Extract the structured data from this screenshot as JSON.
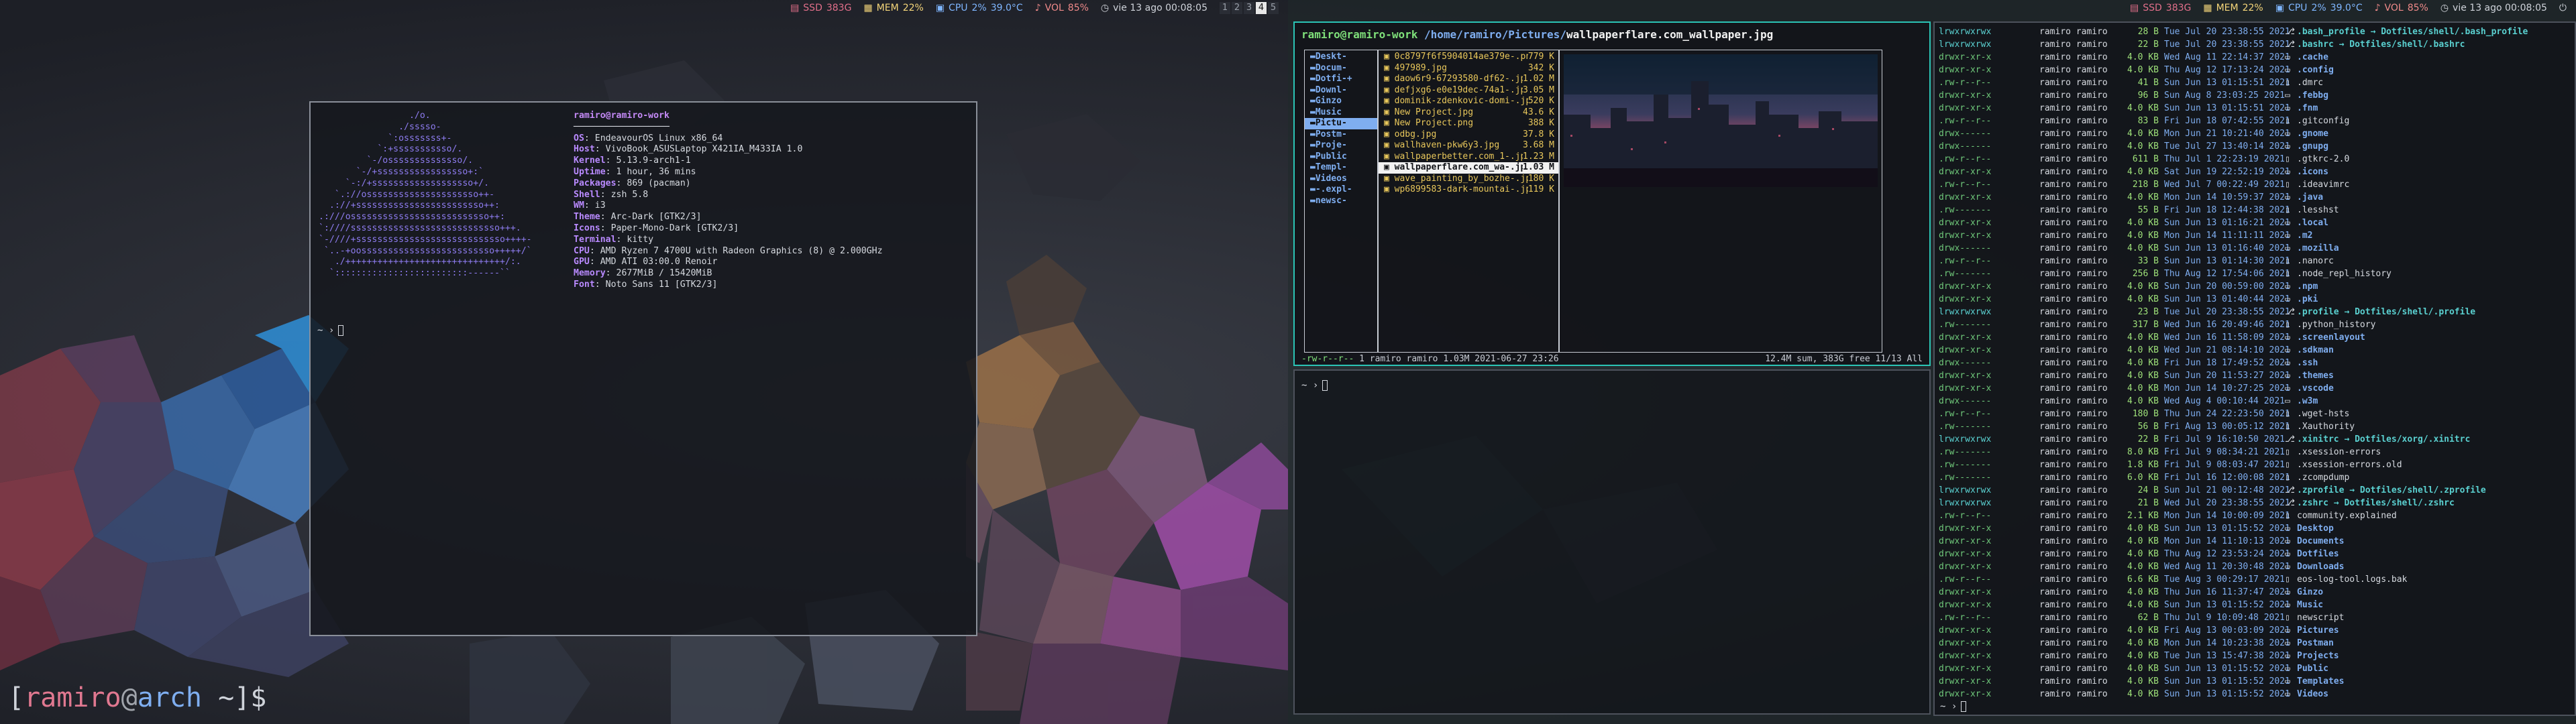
{
  "status_left": {
    "ssd_label": "SSD",
    "ssd_value": "383G",
    "mem_label": "MEM",
    "mem_value": "22%",
    "cpu_label": "CPU",
    "cpu_value": "2%",
    "temp": "39.0°C",
    "vol_label": "VOL",
    "vol_value": "85%",
    "clock": "vie 13 ago 00:08:05",
    "workspaces": [
      "1",
      "2",
      "3",
      "4",
      "5"
    ],
    "active_workspace": "4"
  },
  "status_right": {
    "ssd_label": "SSD",
    "ssd_value": "383G",
    "mem_label": "MEM",
    "mem_value": "22%",
    "cpu_label": "CPU",
    "cpu_value": "2%",
    "temp": "39.0°C",
    "vol_label": "VOL",
    "vol_value": "85%",
    "clock": "vie 13 ago 00:08:05"
  },
  "neofetch": {
    "user_host": "ramiro@ramiro-work",
    "separator": "──────────────────",
    "logo": "                 ./o.\n               ./sssso-\n             `:osssssss+-\n           `:+sssssssssso/.\n         `-/ossssssssssssso/.\n       `-/+sssssssssssssssso+:`\n     `-:/+sssssssssssssssssso+/.\n   `.://osssssssssssssssssssso++-\n  .://+ssssssssssssssssssssssso++:\n.:///ossssssssssssssssssssssssso++:\n`:////ssssssssssssssssssssssssssso+++.\n`-////+ssssssssssssssssssssssssssso++++-\n `..-+oosssssssssssssssssssssssso+++++/`\n   ./++++++++++++++++++++++++++++++/:.\n  `:::::::::::::::::::::::::------``",
    "lines": [
      {
        "k": "OS",
        "v": "EndeavourOS Linux x86_64"
      },
      {
        "k": "Host",
        "v": "VivoBook_ASUSLaptop X421IA_M433IA 1.0"
      },
      {
        "k": "Kernel",
        "v": "5.13.9-arch1-1"
      },
      {
        "k": "Uptime",
        "v": "1 hour, 36 mins"
      },
      {
        "k": "Packages",
        "v": "869 (pacman)"
      },
      {
        "k": "Shell",
        "v": "zsh 5.8"
      },
      {
        "k": "WM",
        "v": "i3"
      },
      {
        "k": "Theme",
        "v": "Arc-Dark [GTK2/3]"
      },
      {
        "k": "Icons",
        "v": "Paper-Mono-Dark [GTK2/3]"
      },
      {
        "k": "Terminal",
        "v": "kitty"
      },
      {
        "k": "CPU",
        "v": "AMD Ryzen 7 4700U with Radeon Graphics (8) @ 2.000GHz"
      },
      {
        "k": "GPU",
        "v": "AMD ATI 03:00.0 Renoir"
      },
      {
        "k": "Memory",
        "v": "2677MiB / 15420MiB"
      },
      {
        "k": "Font",
        "v": "Noto Sans 11 [GTK2/3]"
      }
    ],
    "prompt": "~ ›"
  },
  "desktop_prompt": {
    "open": "[",
    "user": "ramiro",
    "at": "@",
    "host": "arch",
    "rest": " ~]$"
  },
  "ranger": {
    "title_user": "ramiro@ramiro-work",
    "title_path": " /home/ramiro/Pictures/",
    "title_file": "wallpaperflare.com_wallpaper.jpg",
    "parent_dirs": [
      "Deskt-",
      "Docum-",
      "Dotfi-+",
      "Downl-",
      "Ginzo",
      "Music",
      "Pictu-",
      "Postm-",
      "Proje-",
      "Public",
      "Templ-",
      "Videos",
      "-.expl-",
      "newsc-"
    ],
    "parent_selected": "Pictu-",
    "files": [
      {
        "name": "0c8797f6f5904014ae379e-.png",
        "size": "779 K"
      },
      {
        "name": "497989.jpg",
        "size": "342 K"
      },
      {
        "name": "daow6r9-67293580-df62-.jpg",
        "size": "1.02 M"
      },
      {
        "name": "defjxg6-e0e19dec-74a1-.jpg",
        "size": "3.05 M"
      },
      {
        "name": "dominik-zdenkovic-domi-.jpg",
        "size": "520 K"
      },
      {
        "name": "New Project.jpg",
        "size": "43.6 K"
      },
      {
        "name": "New Project.png",
        "size": "388 K"
      },
      {
        "name": "odbg.jpg",
        "size": "37.8 K"
      },
      {
        "name": "wallhaven-pkw6y3.jpg",
        "size": "3.68 M"
      },
      {
        "name": "wallpaperbetter.com_1-.jpg",
        "size": "1.23 M"
      },
      {
        "name": "wallpaperflare.com_wa-.jpg",
        "size": "1.03 M"
      },
      {
        "name": "wave_painting_by_bozhe-.jpg",
        "size": "180 K"
      },
      {
        "name": "wp6899583-dark-mountai-.jpg",
        "size": "119 K"
      }
    ],
    "selected_file": "wallpaperflare.com_wa-.jpg",
    "status_perm": "-rw-r--r--",
    "status_info": " 1 ramiro ramiro 1.03M 2021-06-27 23:26",
    "status_right": "12.4M sum, 383G free  11/13  All"
  },
  "term2": {
    "prompt": "~ ›"
  },
  "ls": {
    "rows": [
      {
        "p": "lrwxrwxrwx",
        "o": "ramiro ramiro",
        "s": "28 B",
        "d": "Tue Jul 20 23:38:55 2021",
        "i": "⎇",
        "n": ".bash_profile → Dotfiles/shell/.bash_profile",
        "t": "ln"
      },
      {
        "p": "lrwxrwxrwx",
        "o": "ramiro ramiro",
        "s": "22 B",
        "d": "Tue Jul 20 23:38:55 2021",
        "i": "⎇",
        "n": ".bashrc → Dotfiles/shell/.bashrc",
        "t": "ln"
      },
      {
        "p": "drwxr-xr-x",
        "o": "ramiro ramiro",
        "s": "4.0 KB",
        "d": "Wed Aug 11 22:14:37 2021",
        "i": "▭",
        "n": ".cache",
        "t": "d"
      },
      {
        "p": "drwxr-xr-x",
        "o": "ramiro ramiro",
        "s": "4.0 KB",
        "d": "Thu Aug 12 17:13:24 2021",
        "i": "▭",
        "n": ".config",
        "t": "d"
      },
      {
        "p": ".rw-r--r--",
        "o": "ramiro ramiro",
        "s": "41 B",
        "d": "Sun Jun 13 01:15:51 2021",
        "i": "▯",
        "n": ".dmrc",
        "t": "f"
      },
      {
        "p": "drwxr-xr-x",
        "o": "ramiro ramiro",
        "s": "96 B",
        "d": "Sun Aug 8 23:03:25 2021",
        "i": "▭",
        "n": ".febbg",
        "t": "d"
      },
      {
        "p": "drwxr-xr-x",
        "o": "ramiro ramiro",
        "s": "4.0 KB",
        "d": "Sun Jun 13 01:15:51 2021",
        "i": "▭",
        "n": ".fnm",
        "t": "d"
      },
      {
        "p": ".rw-r--r--",
        "o": "ramiro ramiro",
        "s": "83 B",
        "d": "Fri Jun 18 07:42:55 2021",
        "i": "▯",
        "n": ".gitconfig",
        "t": "f"
      },
      {
        "p": "drwx------",
        "o": "ramiro ramiro",
        "s": "4.0 KB",
        "d": "Mon Jun 21 10:21:40 2021",
        "i": "▭",
        "n": ".gnome",
        "t": "d"
      },
      {
        "p": "drwx------",
        "o": "ramiro ramiro",
        "s": "4.0 KB",
        "d": "Tue Jul 27 13:40:14 2021",
        "i": "▭",
        "n": ".gnupg",
        "t": "d"
      },
      {
        "p": ".rw-r--r--",
        "o": "ramiro ramiro",
        "s": "611 B",
        "d": "Thu Jul 1 22:23:19 2021",
        "i": "▯",
        "n": ".gtkrc-2.0",
        "t": "f"
      },
      {
        "p": "drwxr-xr-x",
        "o": "ramiro ramiro",
        "s": "4.0 KB",
        "d": "Sat Jun 19 22:52:19 2021",
        "i": "▭",
        "n": ".icons",
        "t": "d"
      },
      {
        "p": ".rw-r--r--",
        "o": "ramiro ramiro",
        "s": "218 B",
        "d": "Wed Jul 7 00:22:49 2021",
        "i": "▯",
        "n": ".ideavimrc",
        "t": "f"
      },
      {
        "p": "drwxr-xr-x",
        "o": "ramiro ramiro",
        "s": "4.0 KB",
        "d": "Mon Jun 14 10:59:37 2021",
        "i": "▭",
        "n": ".java",
        "t": "d"
      },
      {
        "p": ".rw-------",
        "o": "ramiro ramiro",
        "s": "55 B",
        "d": "Fri Jun 18 12:44:38 2021",
        "i": "▯",
        "n": ".lesshst",
        "t": "f"
      },
      {
        "p": "drwxr-xr-x",
        "o": "ramiro ramiro",
        "s": "4.0 KB",
        "d": "Sun Jun 13 01:16:21 2021",
        "i": "▭",
        "n": ".local",
        "t": "d"
      },
      {
        "p": "drwxr-xr-x",
        "o": "ramiro ramiro",
        "s": "4.0 KB",
        "d": "Mon Jun 14 11:11:11 2021",
        "i": "▭",
        "n": ".m2",
        "t": "d"
      },
      {
        "p": "drwx------",
        "o": "ramiro ramiro",
        "s": "4.0 KB",
        "d": "Sun Jun 13 01:16:40 2021",
        "i": "▭",
        "n": ".mozilla",
        "t": "d"
      },
      {
        "p": ".rw-r--r--",
        "o": "ramiro ramiro",
        "s": "33 B",
        "d": "Sun Jun 13 01:14:30 2021",
        "i": "▯",
        "n": ".nanorc",
        "t": "f"
      },
      {
        "p": ".rw-------",
        "o": "ramiro ramiro",
        "s": "256 B",
        "d": "Thu Aug 12 17:54:06 2021",
        "i": "▯",
        "n": ".node_repl_history",
        "t": "f"
      },
      {
        "p": "drwxr-xr-x",
        "o": "ramiro ramiro",
        "s": "4.0 KB",
        "d": "Sun Jun 20 00:59:00 2021",
        "i": "▭",
        "n": ".npm",
        "t": "d"
      },
      {
        "p": "drwxr-xr-x",
        "o": "ramiro ramiro",
        "s": "4.0 KB",
        "d": "Sun Jun 13 01:40:44 2021",
        "i": "▭",
        "n": ".pki",
        "t": "d"
      },
      {
        "p": "lrwxrwxrwx",
        "o": "ramiro ramiro",
        "s": "23 B",
        "d": "Tue Jul 20 23:38:55 2021",
        "i": "⎇",
        "n": ".profile → Dotfiles/shell/.profile",
        "t": "ln"
      },
      {
        "p": ".rw-------",
        "o": "ramiro ramiro",
        "s": "317 B",
        "d": "Wed Jun 16 20:49:46 2021",
        "i": "▯",
        "n": ".python_history",
        "t": "f"
      },
      {
        "p": "drwxr-xr-x",
        "o": "ramiro ramiro",
        "s": "4.0 KB",
        "d": "Wed Jun 16 11:58:09 2021",
        "i": "▭",
        "n": ".screenlayout",
        "t": "d"
      },
      {
        "p": "drwxr-xr-x",
        "o": "ramiro ramiro",
        "s": "4.0 KB",
        "d": "Wed Jun 21 08:14:10 2021",
        "i": "▭",
        "n": ".sdkman",
        "t": "d"
      },
      {
        "p": "drwx------",
        "o": "ramiro ramiro",
        "s": "4.0 KB",
        "d": "Fri Jun 18 17:49:52 2021",
        "i": "▭",
        "n": ".ssh",
        "t": "d"
      },
      {
        "p": "drwxr-xr-x",
        "o": "ramiro ramiro",
        "s": "4.0 KB",
        "d": "Sun Jun 20 11:53:27 2021",
        "i": "▭",
        "n": ".themes",
        "t": "d"
      },
      {
        "p": "drwxr-xr-x",
        "o": "ramiro ramiro",
        "s": "4.0 KB",
        "d": "Mon Jun 14 10:27:25 2021",
        "i": "▭",
        "n": ".vscode",
        "t": "d"
      },
      {
        "p": "drwx------",
        "o": "ramiro ramiro",
        "s": "4.0 KB",
        "d": "Wed Aug 4 00:10:44 2021",
        "i": "▭",
        "n": ".w3m",
        "t": "d"
      },
      {
        "p": ".rw-r--r--",
        "o": "ramiro ramiro",
        "s": "180 B",
        "d": "Thu Jun 24 22:23:50 2021",
        "i": "▯",
        "n": ".wget-hsts",
        "t": "f"
      },
      {
        "p": ".rw-------",
        "o": "ramiro ramiro",
        "s": "56 B",
        "d": "Fri Aug 13 00:05:12 2021",
        "i": "▯",
        "n": ".Xauthority",
        "t": "f"
      },
      {
        "p": "lrwxrwxrwx",
        "o": "ramiro ramiro",
        "s": "22 B",
        "d": "Fri Jul 9 16:10:50 2021",
        "i": "⎇",
        "n": ".xinitrc → Dotfiles/xorg/.xinitrc",
        "t": "ln"
      },
      {
        "p": ".rw-------",
        "o": "ramiro ramiro",
        "s": "8.0 KB",
        "d": "Fri Jul 9 08:34:21 2021",
        "i": "▯",
        "n": ".xsession-errors",
        "t": "f"
      },
      {
        "p": ".rw-------",
        "o": "ramiro ramiro",
        "s": "1.8 KB",
        "d": "Fri Jul 9 08:03:47 2021",
        "i": "▯",
        "n": ".xsession-errors.old",
        "t": "f"
      },
      {
        "p": ".rw-------",
        "o": "ramiro ramiro",
        "s": "6.0 KB",
        "d": "Fri Jul 16 12:00:08 2021",
        "i": "▯",
        "n": ".zcompdump",
        "t": "f"
      },
      {
        "p": "lrwxrwxrwx",
        "o": "ramiro ramiro",
        "s": "24 B",
        "d": "Sun Jul 21 00:12:48 2021",
        "i": "⎇",
        "n": ".zprofile → Dotfiles/shell/.zprofile",
        "t": "ln"
      },
      {
        "p": "lrwxrwxrwx",
        "o": "ramiro ramiro",
        "s": "21 B",
        "d": "Wed Jul 20 23:38:55 2021",
        "i": "⎇",
        "n": ".zshrc → Dotfiles/shell/.zshrc",
        "t": "ln"
      },
      {
        "p": ".rw-r--r--",
        "o": "ramiro ramiro",
        "s": "2.1 KB",
        "d": "Mon Jun 14 10:00:09 2021",
        "i": "▯",
        "n": "community.explained",
        "t": "f"
      },
      {
        "p": "drwxr-xr-x",
        "o": "ramiro ramiro",
        "s": "4.0 KB",
        "d": "Sun Jun 13 01:15:52 2021",
        "i": "▭",
        "n": "Desktop",
        "t": "d"
      },
      {
        "p": "drwxr-xr-x",
        "o": "ramiro ramiro",
        "s": "4.0 KB",
        "d": "Mon Jun 14 11:10:13 2021",
        "i": "▭",
        "n": "Documents",
        "t": "d"
      },
      {
        "p": "drwxr-xr-x",
        "o": "ramiro ramiro",
        "s": "4.0 KB",
        "d": "Thu Aug 12 23:53:24 2021",
        "i": "▭",
        "n": "Dotfiles",
        "t": "d"
      },
      {
        "p": "drwxr-xr-x",
        "o": "ramiro ramiro",
        "s": "4.0 KB",
        "d": "Wed Aug 11 20:30:48 2021",
        "i": "▭",
        "n": "Downloads",
        "t": "d"
      },
      {
        "p": ".rw-r--r--",
        "o": "ramiro ramiro",
        "s": "6.6 KB",
        "d": "Tue Aug 3 00:29:17 2021",
        "i": "▯",
        "n": "eos-log-tool.logs.bak",
        "t": "f"
      },
      {
        "p": "drwxr-xr-x",
        "o": "ramiro ramiro",
        "s": "4.0 KB",
        "d": "Thu Jun 16 11:37:47 2021",
        "i": "▭",
        "n": "Ginzo",
        "t": "d"
      },
      {
        "p": "drwxr-xr-x",
        "o": "ramiro ramiro",
        "s": "4.0 KB",
        "d": "Sun Jun 13 01:15:52 2021",
        "i": "▭",
        "n": "Music",
        "t": "d"
      },
      {
        "p": ".rw-r--r--",
        "o": "ramiro ramiro",
        "s": "62 B",
        "d": "Thu Jul 9 10:09:48 2021",
        "i": "▯",
        "n": "newscript",
        "t": "f"
      },
      {
        "p": "drwxr-xr-x",
        "o": "ramiro ramiro",
        "s": "4.0 KB",
        "d": "Fri Aug 13 00:03:09 2021",
        "i": "▭",
        "n": "Pictures",
        "t": "d"
      },
      {
        "p": "drwxr-xr-x",
        "o": "ramiro ramiro",
        "s": "4.0 KB",
        "d": "Mon Jun 14 10:23:38 2021",
        "i": "▭",
        "n": "Postman",
        "t": "d"
      },
      {
        "p": "drwxr-xr-x",
        "o": "ramiro ramiro",
        "s": "4.0 KB",
        "d": "Tue Jun 13 15:47:38 2021",
        "i": "▭",
        "n": "Projects",
        "t": "d"
      },
      {
        "p": "drwxr-xr-x",
        "o": "ramiro ramiro",
        "s": "4.0 KB",
        "d": "Sun Jun 13 01:15:52 2021",
        "i": "▭",
        "n": "Public",
        "t": "d"
      },
      {
        "p": "drwxr-xr-x",
        "o": "ramiro ramiro",
        "s": "4.0 KB",
        "d": "Sun Jun 13 01:15:52 2021",
        "i": "▭",
        "n": "Templates",
        "t": "d"
      },
      {
        "p": "drwxr-xr-x",
        "o": "ramiro ramiro",
        "s": "4.0 KB",
        "d": "Sun Jun 13 01:15:52 2021",
        "i": "▭",
        "n": "Videos",
        "t": "d"
      }
    ],
    "prompt": "~ ›"
  }
}
